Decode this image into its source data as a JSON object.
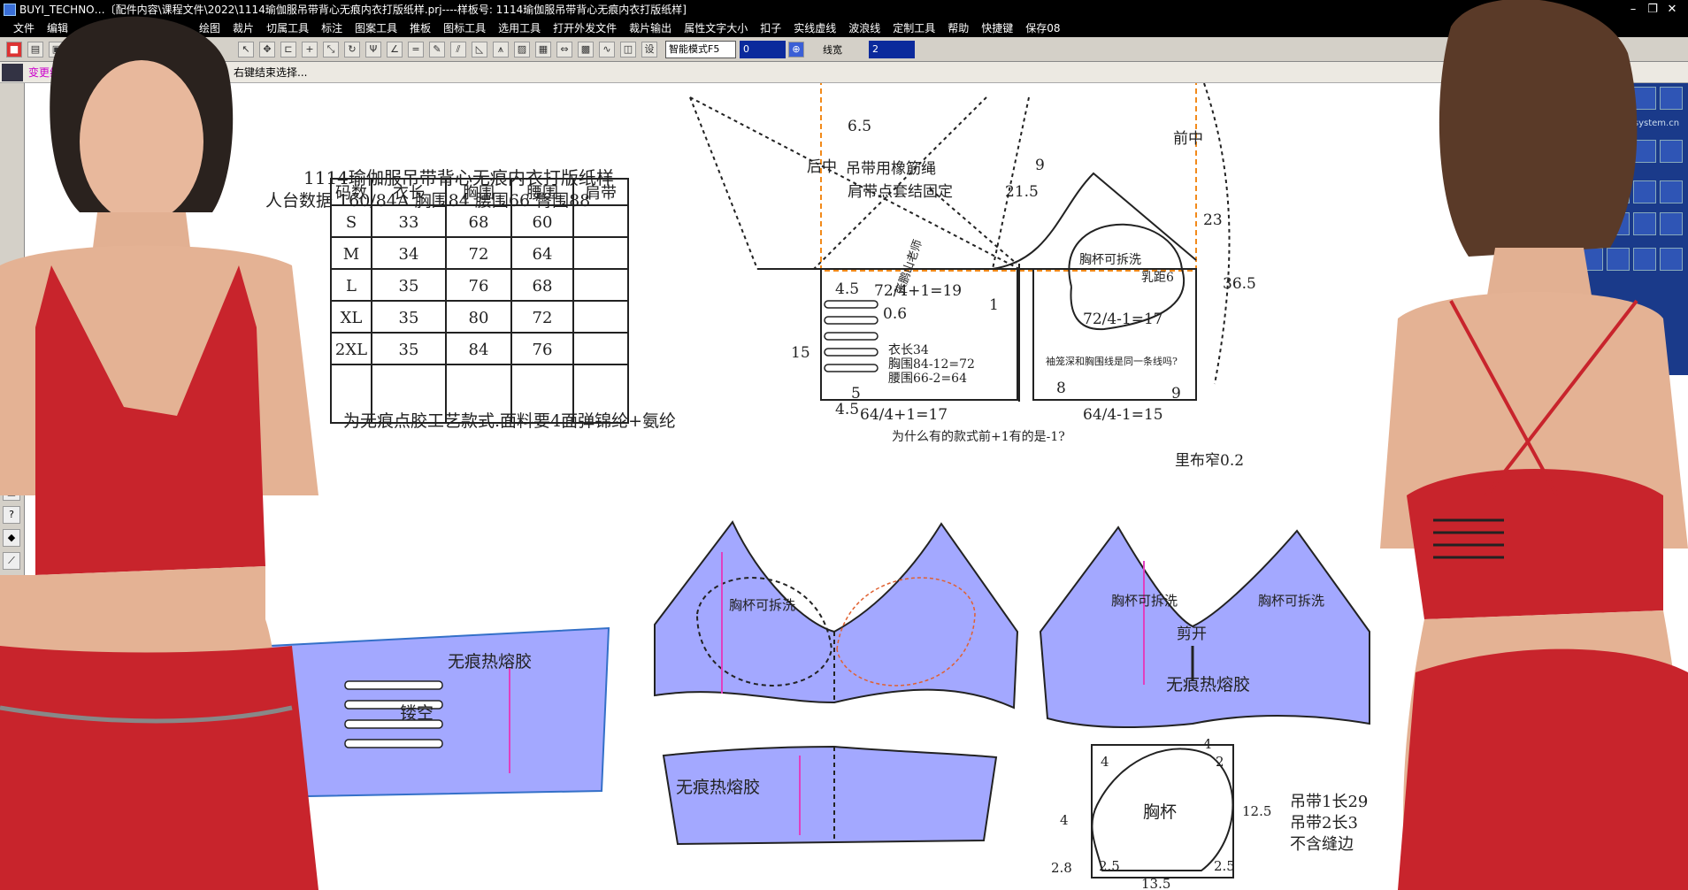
{
  "titlebar": {
    "text": "BUYI_TECHNO…〔配件内容\\课程文件\\2022\\1114瑜伽服吊带背心无痕内衣打版纸样.prj----样板号: 1114瑜伽服吊带背心无痕内衣打版纸样]",
    "controls": [
      "–",
      "❐",
      "✕"
    ]
  },
  "menu": [
    "文件",
    "编辑",
    "",
    "",
    "",
    "绘图",
    "裁片",
    "切属工具",
    "标注",
    "图案工具",
    "推板",
    "图标工具",
    "选用工具",
    "打开外发文件",
    "裁片输出",
    "属性文字大小",
    "扣子",
    "实线虚线",
    "波浪线",
    "定制工具",
    "帮助",
    "快捷键",
    "保存08"
  ],
  "toolbar": {
    "mode": "智能模式F5",
    "field1": "0",
    "line_width_label": "线宽",
    "line_width": "2"
  },
  "statusbar": {
    "tag": "变更线",
    "hint": "右键结束选择..."
  },
  "right_palette": {
    "url": "www.etsystem.cn"
  },
  "pattern": {
    "heading": "1114瑜伽服吊带背心无痕内衣打版纸样",
    "size_data": "人台数据  160/84A   胸围84   腰围66   臀围88",
    "table": {
      "headers": [
        "码数",
        "衣长",
        "胸围",
        "腰围",
        "肩带"
      ],
      "rows": [
        [
          "S",
          "33",
          "68",
          "60",
          ""
        ],
        [
          "M",
          "34",
          "72",
          "64",
          ""
        ],
        [
          "L",
          "35",
          "76",
          "68",
          ""
        ],
        [
          "XL",
          "35",
          "80",
          "72",
          ""
        ],
        [
          "2XL",
          "35",
          "84",
          "76",
          ""
        ]
      ]
    },
    "note": "为无痕点胶工艺款式.面料要4面弹锦纶+氨纶",
    "signature": "张鹏山老师",
    "back_center": "后中",
    "strap_note": "吊带用橡筋绳",
    "strap_note2": "肩带点套结固定",
    "front_center": "前中",
    "cup_foldable": "胸杯可拆洗",
    "nipple": "乳距6",
    "dim_6_5": "6.5",
    "dim_9": "9",
    "dim_21_5": "21.5",
    "dim_23": "23",
    "dim_36_5": "36.5",
    "dim_4_5a": "4.5",
    "dim_back_top": "72/4+1=19",
    "dim_1": "1",
    "dim_front_top": "72/4-1=17",
    "dim_0_6": "0.6",
    "dim_15": "15",
    "spec_len": "衣长34",
    "spec_bust": "胸围84-12=72",
    "spec_waist": "腰围66-2=64",
    "armhole_q": "袖笼深和胸围线是同一条线吗?",
    "dim_8": "8",
    "dim_9b": "9",
    "dim_5": "5",
    "dim_4_5b": "4.5",
    "dim_back_bottom": "64/4+1=17",
    "dim_front_bottom": "64/4-1=15",
    "question": "为什么有的款式前+1有的是-1?",
    "lining": "里布窄0.2",
    "seamless_glue": "无痕热熔胶",
    "hollow": "镂空",
    "cut_open": "剪开",
    "cup_label": "胸杯",
    "cup_dims": [
      "4",
      "4",
      "2",
      "4",
      "12.5",
      "2.8",
      "2.5",
      "2.5",
      "13.5"
    ],
    "strap1": "吊带1长29",
    "strap2": "吊带2长3",
    "no_seam": "不含缝边"
  }
}
